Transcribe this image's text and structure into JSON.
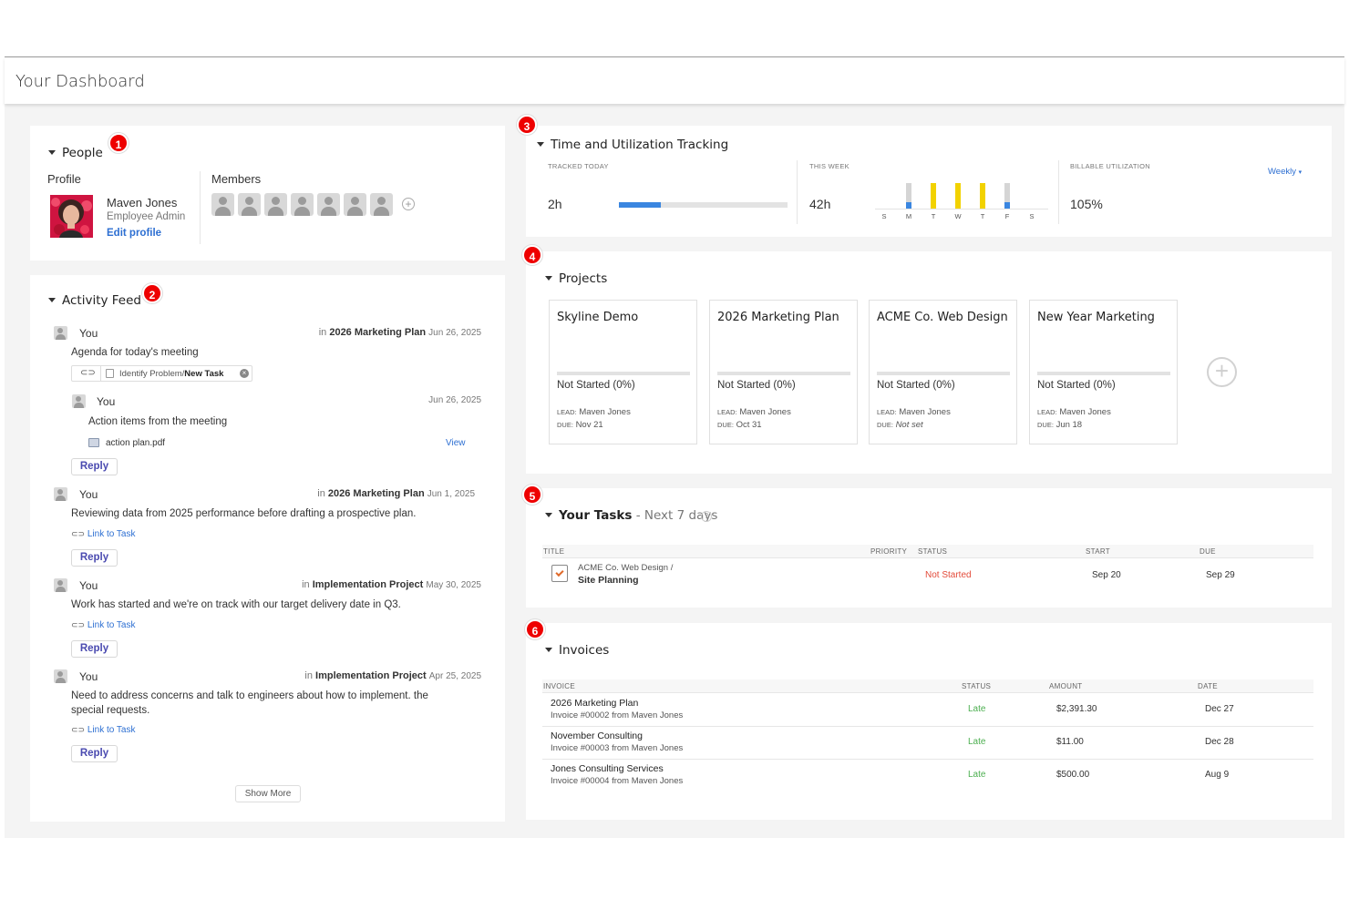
{
  "dashboard": {
    "title": "Your Dashboard"
  },
  "people": {
    "title": "People",
    "badge": "1",
    "profile_label": "Profile",
    "members_label": "Members",
    "name": "Maven Jones",
    "role": "Employee Admin",
    "edit_link": "Edit profile",
    "member_count": 7
  },
  "activity": {
    "title": "Activity Feed",
    "badge": "2",
    "items": [
      {
        "user": "You",
        "in_prefix": "in",
        "project": "2026 Marketing Plan",
        "date": "Jun 26, 2025",
        "text": "Agenda for today's meeting",
        "chip_path": "Identify Problem",
        "chip_task": "New Task",
        "reply": "Reply"
      },
      {
        "user": "You",
        "in_prefix": "in",
        "project": "2026 Marketing Plan",
        "date": "Jun 1, 2025",
        "text": "Reviewing data from 2025 performance before drafting a prospective plan.",
        "link": "Link to Task",
        "reply": "Reply"
      },
      {
        "user": "You",
        "in_prefix": "in",
        "project": "Implementation Project",
        "date": "May 30, 2025",
        "text": "Work has started and we're on track with our target delivery date in Q3.",
        "link": "Link to Task",
        "reply": "Reply"
      },
      {
        "user": "You",
        "in_prefix": "in",
        "project": "Implementation Project",
        "date": "Apr 25, 2025",
        "text": "Need to address concerns and talk to engineers about how to implement. the",
        "text2": "special requests.",
        "link": "Link to Task",
        "reply": "Reply"
      }
    ],
    "nested": {
      "user": "You",
      "date": "Jun 26, 2025",
      "text": "Action items from the meeting",
      "file": "action plan.pdf",
      "view": "View",
      "reply": "Reply"
    },
    "show_more": "Show More"
  },
  "time": {
    "title": "Time and Utilization Tracking",
    "badge": "3",
    "tracked_label": "TRACKED TODAY",
    "tracked_value": "2h",
    "tracked_progress": 0.25,
    "week_label": "THIS WEEK",
    "week_value": "42h",
    "days": [
      "S",
      "M",
      "T",
      "W",
      "T",
      "F",
      "S"
    ],
    "day_levels": [
      0,
      1,
      1,
      1,
      1,
      1,
      0
    ],
    "billable_label": "BILLABLE UTILIZATION",
    "billable_value": "105%",
    "period": "Weekly",
    "colors": {
      "bar_blue": "#3a86e0",
      "bar_yellow": "#f2d200",
      "bar_gray": "#d5d5d5"
    }
  },
  "projects": {
    "title": "Projects",
    "badge": "4",
    "lead_label": "LEAD:",
    "due_label": "DUE:",
    "items": [
      {
        "name": "Skyline Demo",
        "status": "Not Started (0%)",
        "lead": "Maven Jones",
        "due": "Nov 21"
      },
      {
        "name": "2026 Marketing Plan",
        "status": "Not Started (0%)",
        "lead": "Maven Jones",
        "due": "Oct 31"
      },
      {
        "name": "ACME Co. Web Design",
        "status": "Not Started (0%)",
        "lead": "Maven Jones",
        "due": "Not set"
      },
      {
        "name": "New Year Marketing",
        "status": "Not Started (0%)",
        "lead": "Maven Jones",
        "due": "Jun 18"
      }
    ]
  },
  "tasks": {
    "title": "Your Tasks",
    "subtitle": "- Next 7 days",
    "badge": "5",
    "help": "?",
    "columns": [
      "TITLE",
      "PRIORITY",
      "STATUS",
      "START",
      "DUE"
    ],
    "rows": [
      {
        "path": "ACME Co. Web Design /",
        "name": "Site Planning",
        "priority": "",
        "status": "Not Started",
        "start": "Sep 20",
        "due": "Sep 29"
      }
    ]
  },
  "invoices": {
    "title": "Invoices",
    "badge": "6",
    "columns": [
      "INVOICE",
      "STATUS",
      "AMOUNT",
      "DATE"
    ],
    "rows": [
      {
        "name": "2026 Marketing Plan",
        "sub": "Invoice #00002 from Maven Jones",
        "status": "Late",
        "amount": "$2,391.30",
        "date": "Dec 27"
      },
      {
        "name": "November Consulting",
        "sub": "Invoice #00003 from Maven Jones",
        "status": "Late",
        "amount": "$11.00",
        "date": "Dec 28"
      },
      {
        "name": "Jones Consulting Services",
        "sub": "Invoice #00004 from Maven Jones",
        "status": "Late",
        "amount": "$500.00",
        "date": "Aug 9"
      }
    ]
  }
}
